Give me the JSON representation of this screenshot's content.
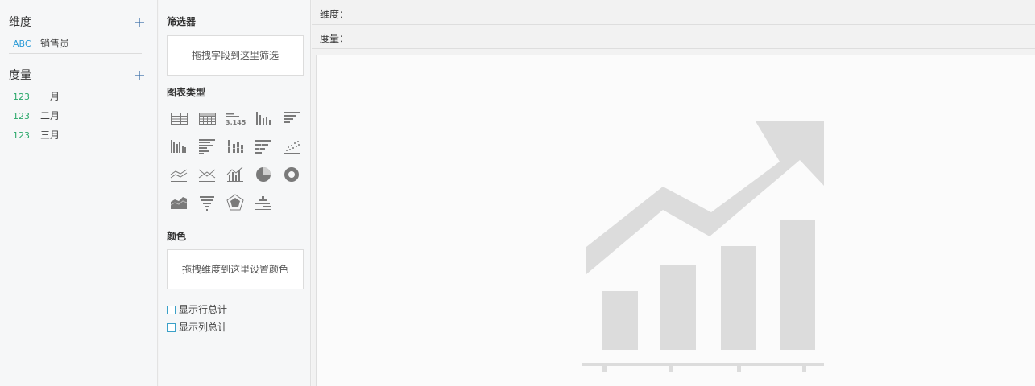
{
  "fields_panel": {
    "dimension_title": "维度",
    "measure_title": "度量",
    "dimensions": [
      {
        "type": "ABC",
        "name": "销售员"
      }
    ],
    "measures": [
      {
        "type": "123",
        "name": "一月"
      },
      {
        "type": "123",
        "name": "二月"
      },
      {
        "type": "123",
        "name": "三月"
      }
    ]
  },
  "config_panel": {
    "filter_title": "筛选器",
    "filter_drop_text": "拖拽字段到这里筛选",
    "chart_type_title": "图表类型",
    "chart_type_icons": [
      "table-icon",
      "crosstab-icon",
      "kpi-number-icon",
      "column-chart-icon",
      "bar-chart-icon",
      "grouped-column-icon",
      "grouped-bar-icon",
      "stacked-column-icon",
      "stacked-bar-icon",
      "scatter-icon",
      "line-chart-icon",
      "area-line-icon",
      "combo-chart-icon",
      "pie-chart-icon",
      "donut-chart-icon",
      "area-chart-icon",
      "funnel-chart-icon",
      "radar-chart-icon",
      "gantt-chart-icon"
    ],
    "kpi_icon_text": "3.145",
    "color_title": "颜色",
    "color_drop_text": "拖拽维度到这里设置颜色",
    "show_row_total": "显示行总计",
    "show_col_total": "显示列总计"
  },
  "canvas": {
    "dimension_shelf_label": "维度：",
    "measure_shelf_label": "度量："
  }
}
